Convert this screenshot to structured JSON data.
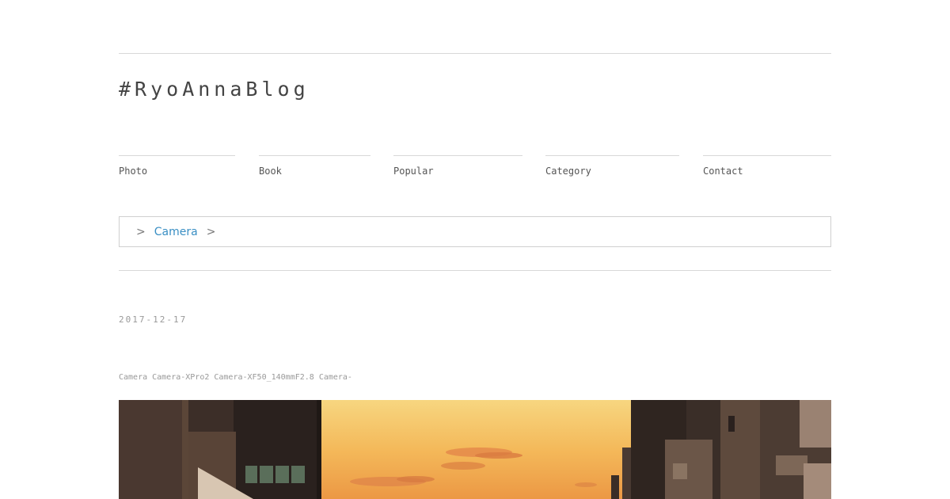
{
  "site": {
    "title": "#RyoAnnaBlog"
  },
  "nav": {
    "items": [
      {
        "label": "Photo"
      },
      {
        "label": "Book"
      },
      {
        "label": "Popular"
      },
      {
        "label": "Category"
      },
      {
        "label": "Contact"
      }
    ]
  },
  "breadcrumb": {
    "separator": ">",
    "current": "Camera"
  },
  "post": {
    "date": "2017-12-17",
    "tags": [
      "Camera",
      "Camera-XPro2",
      "Camera-XF50_140mmF2.8",
      "Camera-"
    ]
  },
  "colors": {
    "link": "#3a8fc4",
    "sky_top": "#f6d27a",
    "sky_bottom": "#ee9a45"
  }
}
